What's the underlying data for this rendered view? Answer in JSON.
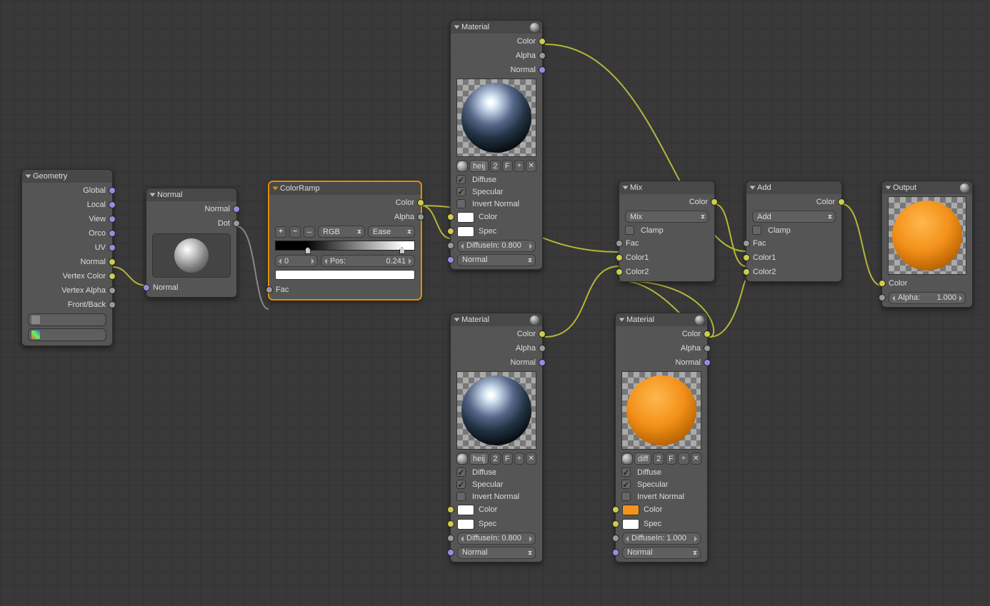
{
  "geometry": {
    "title": "Geometry",
    "outputs": [
      "Global",
      "Local",
      "View",
      "Orco",
      "UV",
      "Normal",
      "Vertex Color",
      "Vertex Alpha",
      "Front/Back"
    ]
  },
  "normal": {
    "title": "Normal",
    "out_normal": "Normal",
    "out_dot": "Dot",
    "in_normal": "Normal"
  },
  "colorramp": {
    "title": "ColorRamp",
    "out_color": "Color",
    "out_alpha": "Alpha",
    "mode1": "RGB",
    "mode2": "Ease",
    "index": "0",
    "pos_label": "Pos:",
    "pos_val": "0.241",
    "in_fac": "Fac"
  },
  "mat1": {
    "title": "Material",
    "out_color": "Color",
    "out_alpha": "Alpha",
    "out_normal": "Normal",
    "name": "heij",
    "users": "2",
    "f": "F",
    "diffuse": "Diffuse",
    "specular": "Specular",
    "invert": "Invert Normal",
    "lbl_color": "Color",
    "lbl_spec": "Spec",
    "diffusein": "DiffuseIn: 0.800",
    "normal": "Normal"
  },
  "mat2": {
    "title": "Material",
    "out_color": "Color",
    "out_alpha": "Alpha",
    "out_normal": "Normal",
    "name": "heij",
    "users": "2",
    "f": "F",
    "diffuse": "Diffuse",
    "specular": "Specular",
    "invert": "Invert Normal",
    "lbl_color": "Color",
    "lbl_spec": "Spec",
    "diffusein": "DiffuseIn: 0.800",
    "normal": "Normal"
  },
  "mat3": {
    "title": "Material",
    "out_color": "Color",
    "out_alpha": "Alpha",
    "out_normal": "Normal",
    "name": "diff",
    "users": "2",
    "f": "F",
    "diffuse": "Diffuse",
    "specular": "Specular",
    "invert": "Invert Normal",
    "lbl_color": "Color",
    "lbl_spec": "Spec",
    "diffusein": "DiffuseIn: 1.000",
    "normal": "Normal"
  },
  "mix": {
    "title": "Mix",
    "out": "Color",
    "mode": "Mix",
    "clamp": "Clamp",
    "fac": "Fac",
    "c1": "Color1",
    "c2": "Color2"
  },
  "add": {
    "title": "Add",
    "out": "Color",
    "mode": "Add",
    "clamp": "Clamp",
    "fac": "Fac",
    "c1": "Color1",
    "c2": "Color2"
  },
  "output": {
    "title": "Output",
    "in_color": "Color",
    "alpha_label": "Alpha:",
    "alpha_val": "1.000"
  }
}
